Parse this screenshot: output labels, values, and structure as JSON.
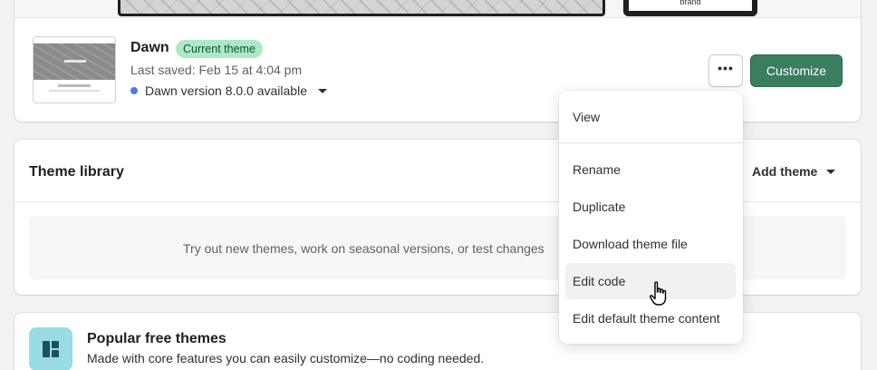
{
  "current_theme": {
    "preview_mobile_text": "brand",
    "name": "Dawn",
    "badge": "Current theme",
    "last_saved": "Last saved: Feb 15 at 4:04 pm",
    "version_notice": "Dawn version 8.0.0 available",
    "more_label": "•••",
    "customize_label": "Customize"
  },
  "library": {
    "title": "Theme library",
    "add_theme_label": "Add theme",
    "empty_text": "Try out new themes, work on seasonal versions, or test changes"
  },
  "popular": {
    "title": "Popular free themes",
    "subtitle": "Made with core features you can easily customize—no coding needed."
  },
  "menu": {
    "items": [
      "View",
      "Rename",
      "Duplicate",
      "Download theme file",
      "Edit code",
      "Edit default theme content"
    ],
    "hovered": "Edit code"
  },
  "colors": {
    "primary_button": "#3a7d5f",
    "badge_bg": "#aee9c6",
    "version_dot": "#4a7ee6",
    "page_bg": "#f1f2f4"
  },
  "icons": [
    "ellipsis-icon",
    "caret-down-icon",
    "layout-icon",
    "pointer-hand-cursor-icon"
  ]
}
